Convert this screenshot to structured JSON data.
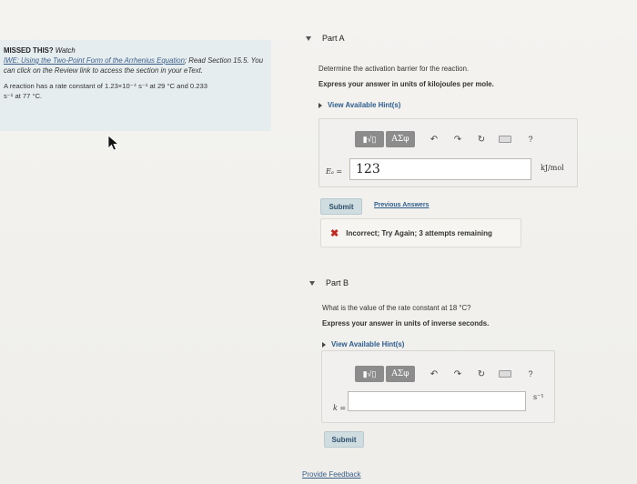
{
  "left": {
    "missed_title": "MISSED THIS?",
    "missed_watch": "Watch",
    "watch_link": "IWE: Using the Two-Point Form of the Arrhenius Equation",
    "read_label": "; Read",
    "section_text": "Section 15.5. You can click on the Review link to access the section in your eText.",
    "problem_line1": "A reaction has a rate constant of 1.23×10⁻⁴ s⁻¹ at 29 °C and 0.233",
    "problem_line2": "s⁻¹ at 77 °C."
  },
  "partA": {
    "title": "Part A",
    "question": "Determine the activation barrier for the reaction.",
    "instruction": "Express your answer in units of kilojoules per mole.",
    "hints": "View Available Hint(s)",
    "toolbar": {
      "templates": "▮√▯",
      "greek": "ΑΣφ"
    },
    "field_label": "Eₐ =",
    "field_value": "123",
    "unit": "kJ/mol",
    "submit": "Submit",
    "previous": "Previous Answers",
    "feedback": "Incorrect; Try Again; 3 attempts remaining"
  },
  "partB": {
    "title": "Part B",
    "question": "What is the value of the rate constant at 18 °C?",
    "instruction": "Express your answer in units of inverse seconds.",
    "hints": "View Available Hint(s)",
    "toolbar": {
      "templates": "▮√▯",
      "greek": "ΑΣφ"
    },
    "field_label": "k =",
    "field_value": "",
    "unit": "s⁻¹",
    "submit": "Submit"
  },
  "footer": {
    "provide_feedback": "Provide Feedback"
  }
}
